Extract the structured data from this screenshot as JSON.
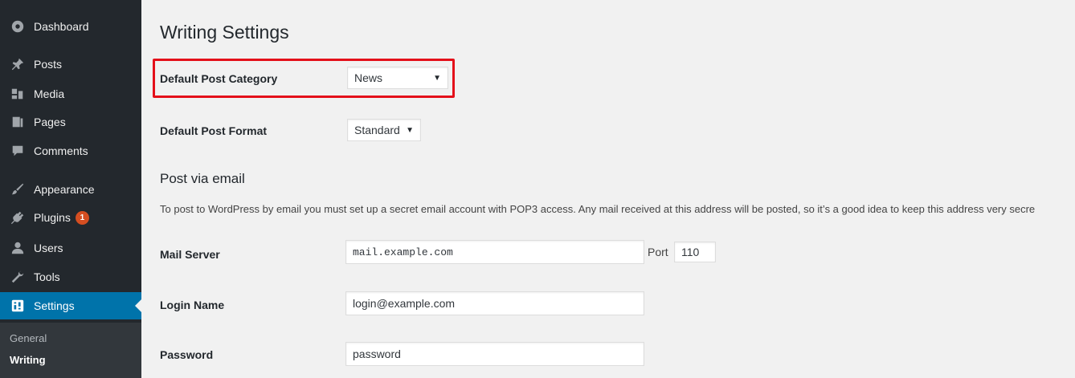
{
  "sidebar": {
    "items": [
      {
        "label": "Dashboard",
        "icon": "dashboard-icon"
      },
      {
        "label": "Posts",
        "icon": "pin-icon"
      },
      {
        "label": "Media",
        "icon": "media-icon"
      },
      {
        "label": "Pages",
        "icon": "pages-icon"
      },
      {
        "label": "Comments",
        "icon": "comment-icon"
      },
      {
        "label": "Appearance",
        "icon": "brush-icon"
      },
      {
        "label": "Plugins",
        "icon": "plug-icon",
        "badge": "1"
      },
      {
        "label": "Users",
        "icon": "user-icon"
      },
      {
        "label": "Tools",
        "icon": "wrench-icon"
      },
      {
        "label": "Settings",
        "icon": "settings-icon",
        "current": true
      }
    ],
    "submenu": [
      {
        "label": "General"
      },
      {
        "label": "Writing",
        "active": true
      }
    ]
  },
  "page": {
    "title": "Writing Settings",
    "default_category": {
      "label": "Default Post Category",
      "value": "News"
    },
    "default_format": {
      "label": "Default Post Format",
      "value": "Standard"
    },
    "post_via_email": {
      "title": "Post via email",
      "description": "To post to WordPress by email you must set up a secret email account with POP3 access. Any mail received at this address will be posted, so it’s a good idea to keep this address very secre"
    },
    "mail_server": {
      "label": "Mail Server",
      "value": "mail.example.com",
      "port_label": "Port",
      "port_value": "110"
    },
    "login_name": {
      "label": "Login Name",
      "value": "login@example.com"
    },
    "password": {
      "label": "Password",
      "value": "password"
    }
  },
  "colors": {
    "sidebar_bg": "#23282d",
    "accent": "#0073aa",
    "highlight_border": "#e4101a",
    "badge": "#d54e21"
  }
}
